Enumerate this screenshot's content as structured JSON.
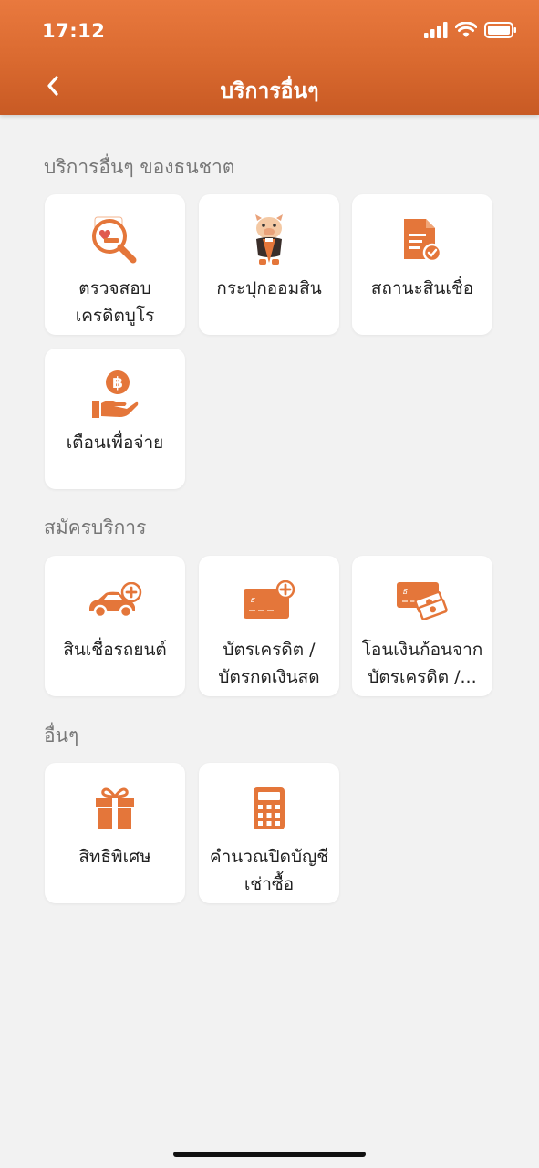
{
  "status_bar": {
    "time": "17:12"
  },
  "header": {
    "title": "บริการอื่นๆ"
  },
  "sections": [
    {
      "title": "บริการอื่นๆ ของธนชาต",
      "items": [
        {
          "label": "ตรวจสอบ\nเครดิตบูโร",
          "icon": "credit-bureau-magnifier-icon"
        },
        {
          "label": "กระปุกออมสิน",
          "icon": "piggy-bank-icon"
        },
        {
          "label": "สถานะสินเชื่อ",
          "icon": "loan-status-document-icon"
        },
        {
          "label": "เตือนเพื่อจ่าย",
          "icon": "payment-reminder-icon"
        }
      ]
    },
    {
      "title": "สมัครบริการ",
      "items": [
        {
          "label": "สินเชื่อรถยนต์",
          "icon": "car-loan-icon"
        },
        {
          "label": "บัตรเครดิต /\nบัตรกดเงินสด",
          "icon": "credit-card-add-icon"
        },
        {
          "label": "โอนเงินก้อนจาก\nบัตรเครดิต /...",
          "icon": "card-cash-transfer-icon"
        }
      ]
    },
    {
      "title": "อื่นๆ",
      "items": [
        {
          "label": "สิทธิพิเศษ",
          "icon": "gift-icon"
        },
        {
          "label": "คำนวณปิดบัญชี\nเช่าซื้อ",
          "icon": "calculator-icon"
        }
      ]
    }
  ],
  "colors": {
    "accent": "#e4763a",
    "header_dark": "#c85a24",
    "background": "#f2f2f2"
  }
}
